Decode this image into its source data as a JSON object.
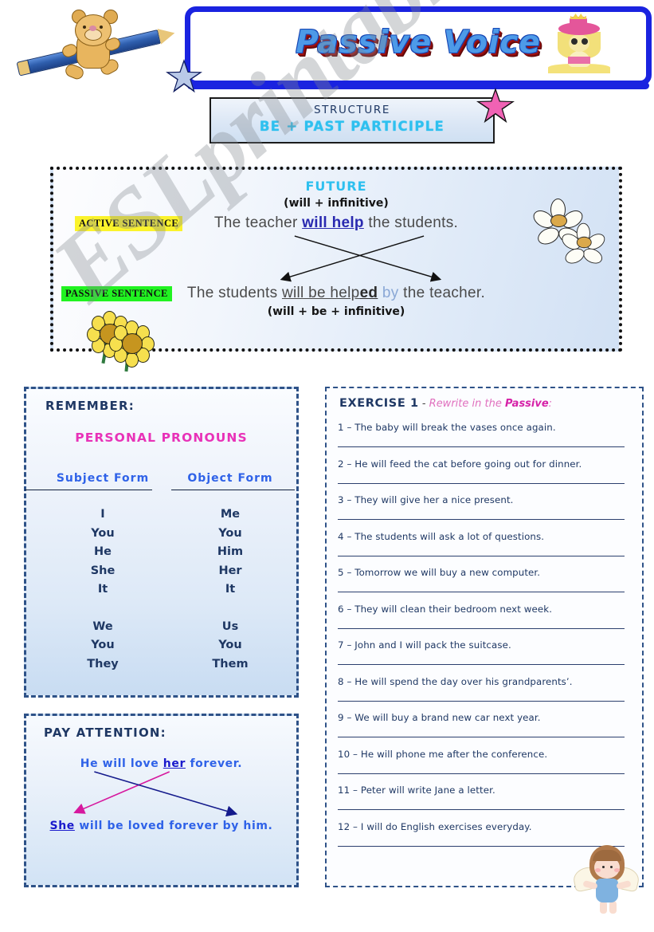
{
  "title": {
    "text": "Passive Voice"
  },
  "structure": {
    "label": "STRUCTURE",
    "formula": "BE + PAST PARTICIPLE"
  },
  "future": {
    "heading": "FUTURE",
    "active_formula": "(will + infinitive)",
    "active_label": "ACTIVE SENTENCE",
    "active_pre": "The teacher ",
    "active_highlight": "will help",
    "active_post": " the students.",
    "passive_label": "PASSIVE  SENTENCE",
    "passive_pre": "The students ",
    "passive_und": "will be help",
    "passive_bold": "ed",
    "passive_by": " by ",
    "passive_post": "the teacher.",
    "passive_formula": "(will + be + infinitive)"
  },
  "remember": {
    "title": "REMEMBER:",
    "section_title": "PERSONAL PRONOUNS",
    "subject_header": "Subject Form",
    "object_header": "Object Form",
    "subject_group1": [
      "I",
      "You",
      "He",
      "She",
      "It"
    ],
    "object_group1": [
      "Me",
      "You",
      "Him",
      "Her",
      "It"
    ],
    "subject_group2": [
      "We",
      "You",
      "They"
    ],
    "object_group2": [
      "Us",
      "You",
      "Them"
    ]
  },
  "attention": {
    "title": "PAY ATTENTION:",
    "active_pre": "He will love ",
    "active_und": "her",
    "active_post": " forever.",
    "passive_und": "She",
    "passive_post": " will be loved forever by him."
  },
  "exercise": {
    "title": "EXERCISE 1",
    "dash": " - ",
    "subtitle_pre": "Rewrite in the ",
    "subtitle_bold": "Passive",
    "subtitle_post": ":",
    "items": [
      "1 – The baby will break the vases once again.",
      "2 – He will feed the cat before going out for dinner.",
      "3 – They will give her a nice present.",
      "4 – The students will ask a lot of questions.",
      "5 – Tomorrow we will buy a new computer.",
      "6 – They will clean their bedroom next week.",
      "7 – John and I will pack the suitcase.",
      "8 – He will spend the day over his grandparents’.",
      "9 – We will buy a brand new car next year.",
      "10 – He will phone me after the conference.",
      "11 – Peter will write Jane a letter.",
      "12 – I will do English exercises everyday."
    ]
  },
  "watermark": {
    "text": "ESLprintables.com"
  },
  "colors": {
    "title_blue": "#4d9ae8",
    "title_shadow_red": "#9e1010",
    "banner_border": "#1a23e0",
    "cyan": "#2ec0ef",
    "navy": "#1f3864",
    "pink": "#e832b8",
    "blue_text": "#2f62e8",
    "active_highlight": "#fbf32c",
    "passive_highlight": "#21f321",
    "arrow_magenta": "#d6189e",
    "arrow_navy": "#141a8c"
  }
}
